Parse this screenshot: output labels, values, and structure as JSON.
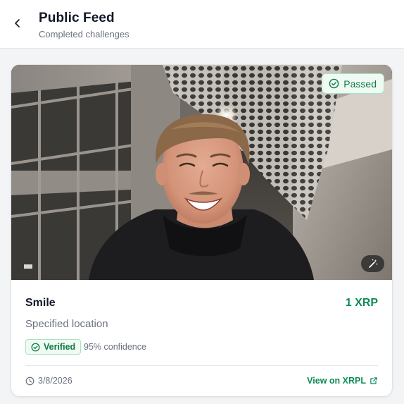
{
  "header": {
    "title": "Public Feed",
    "subtitle": "Completed challenges",
    "back_icon": "chevron-left-icon"
  },
  "post": {
    "status_badge": "Passed",
    "challenge_title": "Smile",
    "reward": "1 XRP",
    "location": "Specified location",
    "verified_label": "Verified",
    "confidence": "95% confidence",
    "date": "3/8/2026",
    "link_label": "View on XRPL"
  },
  "colors": {
    "accent_green": "#0f8a55",
    "badge_bg": "#effaf3",
    "badge_border": "#a7e3c1",
    "muted_text": "#6b7280"
  }
}
